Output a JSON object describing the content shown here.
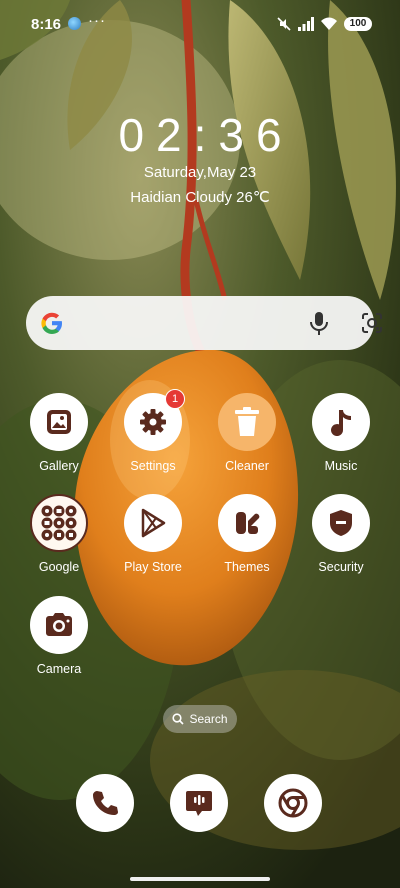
{
  "status_bar": {
    "time": "8:16",
    "more": "···",
    "battery": "100",
    "icons": [
      "globe-icon",
      "mute-icon",
      "signal-icon",
      "wifi-icon",
      "battery-icon"
    ]
  },
  "clock": {
    "time": "02:36",
    "date": "Saturday,May 23",
    "weather": "Haidian Cloudy 26℃"
  },
  "search_bar": {
    "icons": [
      "google-logo-icon",
      "microphone-icon",
      "lens-icon"
    ]
  },
  "apps": [
    {
      "label": "Gallery",
      "icon": "gallery-icon"
    },
    {
      "label": "Settings",
      "icon": "gear-icon",
      "badge": "1"
    },
    {
      "label": "Cleaner",
      "icon": "trash-icon"
    },
    {
      "label": "Music",
      "icon": "music-note-icon"
    },
    {
      "label": "Google",
      "icon": "google-folder-icon"
    },
    {
      "label": "Play Store",
      "icon": "play-store-icon"
    },
    {
      "label": "Themes",
      "icon": "themes-icon"
    },
    {
      "label": "Security",
      "icon": "shield-icon"
    },
    {
      "label": "Camera",
      "icon": "camera-icon"
    }
  ],
  "app_search": {
    "label": "Search",
    "icon": "search-icon"
  },
  "dock": [
    {
      "name": "Phone",
      "icon": "phone-icon"
    },
    {
      "name": "Messages",
      "icon": "message-icon"
    },
    {
      "name": "Chrome",
      "icon": "chrome-icon"
    }
  ],
  "colors": {
    "icon_glyph": "#5a2a1e",
    "cleaner_icon_bg": "#f6b56a",
    "badge": "#e53935",
    "search_bar_bg": "#fafafa"
  }
}
